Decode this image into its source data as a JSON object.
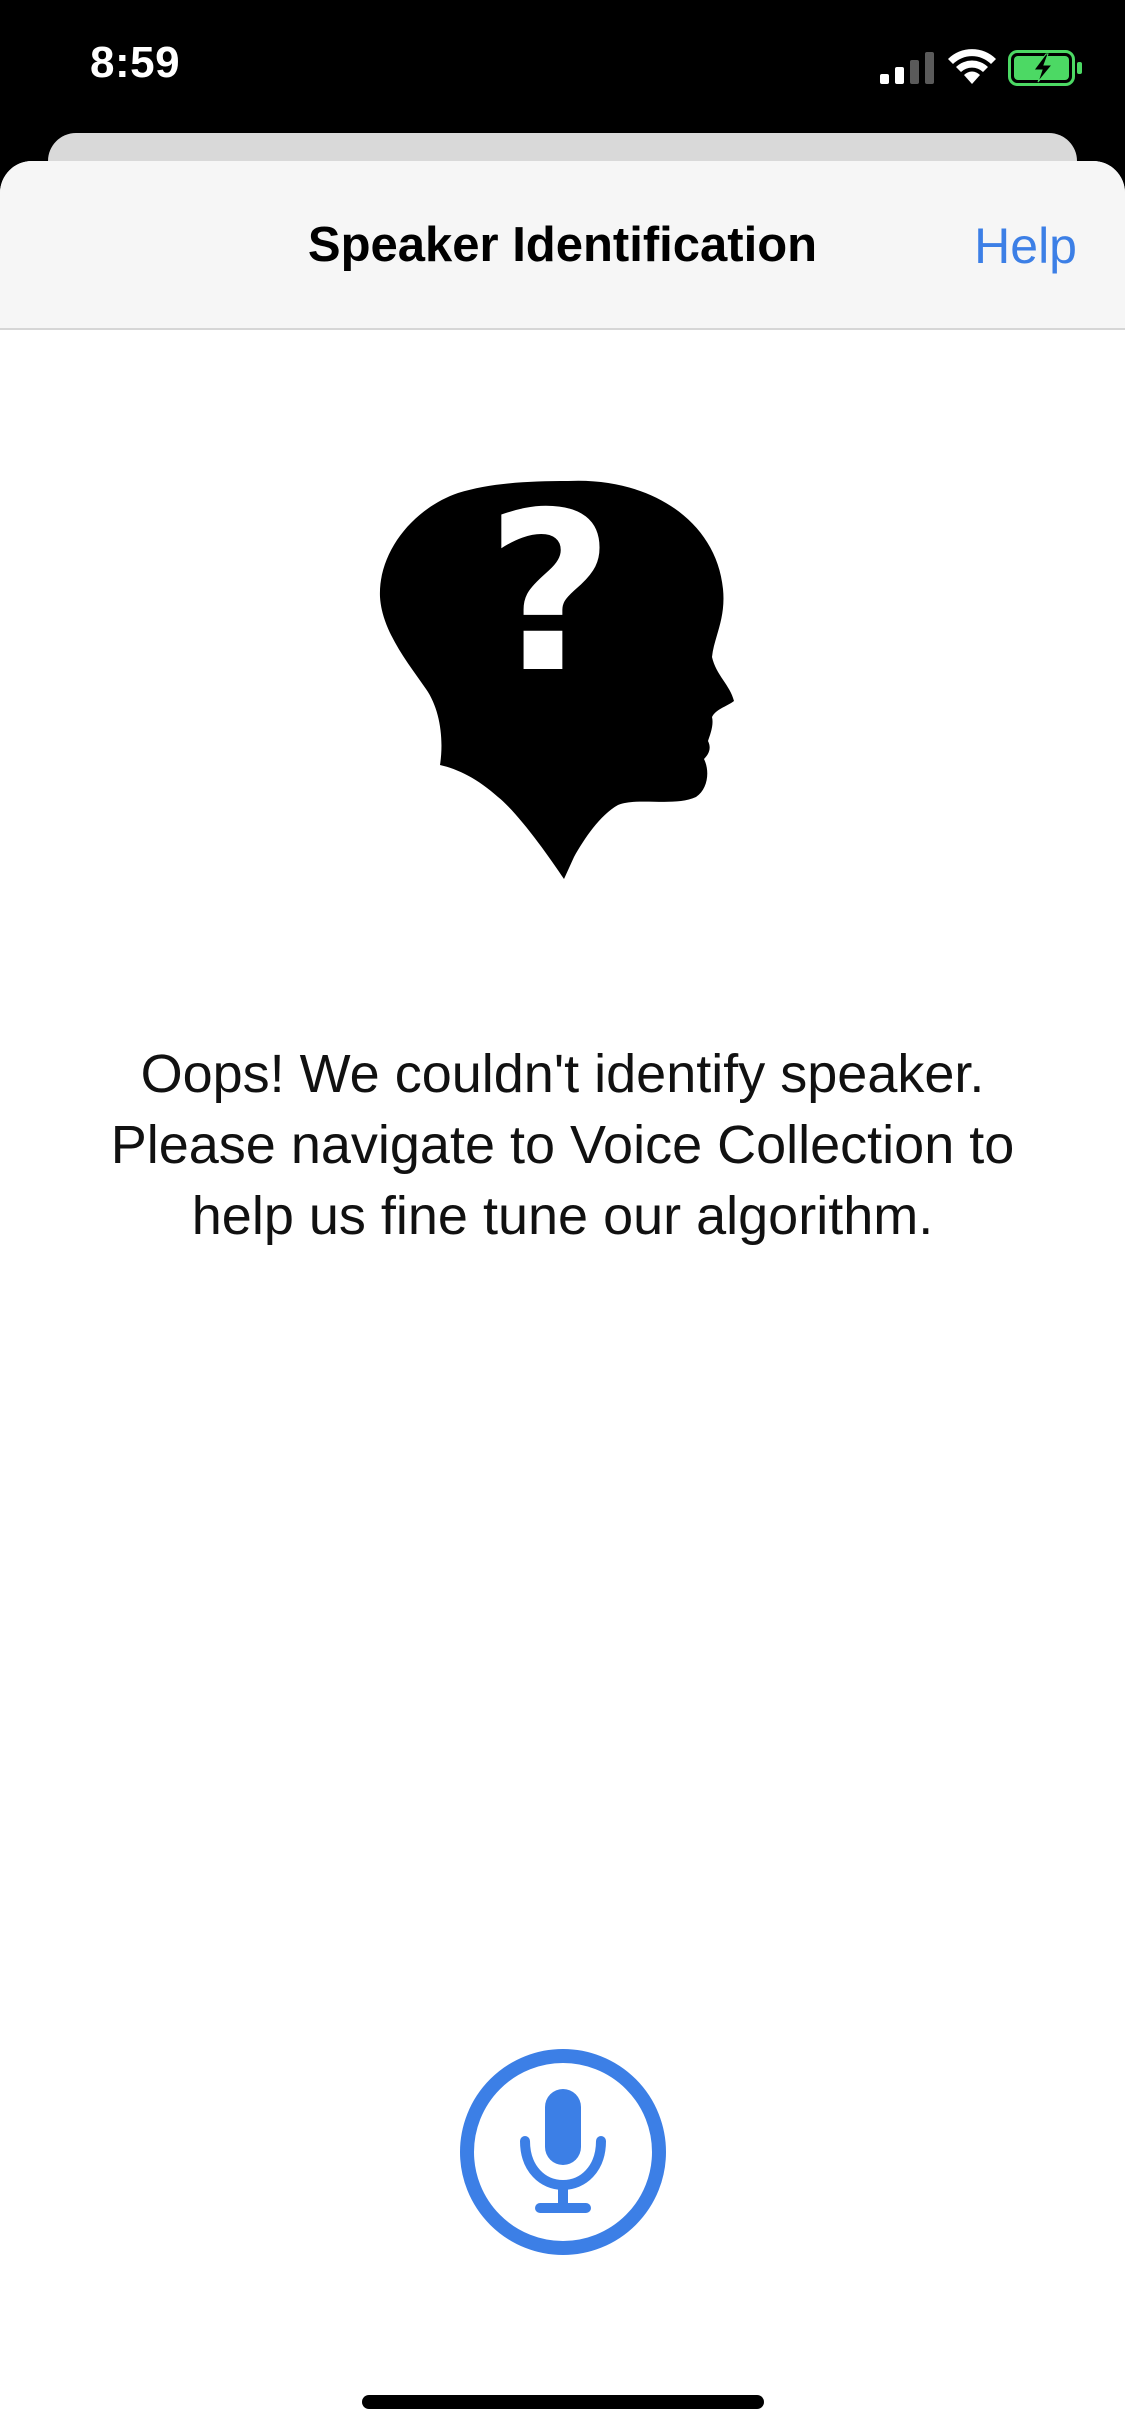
{
  "status_bar": {
    "time": "8:59",
    "icons": [
      "signal-icon",
      "wifi-icon",
      "battery-charging-icon"
    ]
  },
  "nav": {
    "title": "Speaker Identification",
    "help_label": "Help"
  },
  "illustration": {
    "icon": "unknown-person-head-icon",
    "glyph": "?"
  },
  "message": {
    "line1": "Oops! We couldn't identify speaker.",
    "line2": "Please navigate to Voice Collection to",
    "line3": "help us fine tune our algorithm."
  },
  "mic": {
    "icon": "microphone-icon"
  },
  "colors": {
    "accent": "#3c7fe6",
    "battery_fill": "#4cd964"
  }
}
